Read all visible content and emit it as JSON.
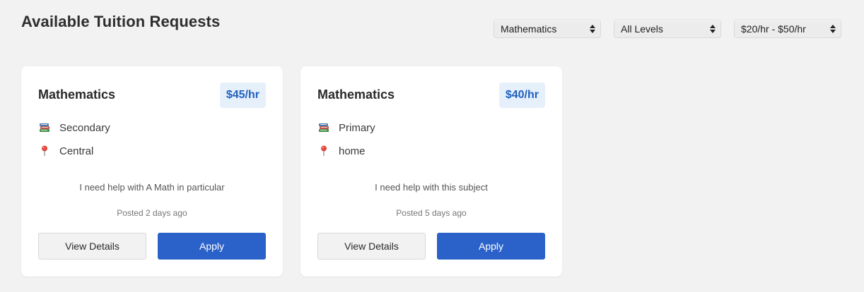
{
  "header": {
    "title": "Available Tuition Requests"
  },
  "filters": {
    "subject": "Mathematics",
    "level": "All Levels",
    "rate": "$20/hr - $50/hr"
  },
  "cards": [
    {
      "subject": "Mathematics",
      "rate": "$45/hr",
      "level": "Secondary",
      "location": "Central",
      "description": "I need help with A Math in particular",
      "posted": "Posted 2 days ago",
      "details_label": "View Details",
      "apply_label": "Apply"
    },
    {
      "subject": "Mathematics",
      "rate": "$40/hr",
      "level": "Primary",
      "location": "home",
      "description": "I need help with this subject",
      "posted": "Posted 5 days ago",
      "details_label": "View Details",
      "apply_label": "Apply"
    }
  ],
  "icons": {
    "level": "books-icon",
    "location": "pushpin-icon"
  },
  "colors": {
    "accent": "#2a62c9",
    "badge_bg": "#e6f0fb",
    "badge_text": "#1f5fbf"
  }
}
